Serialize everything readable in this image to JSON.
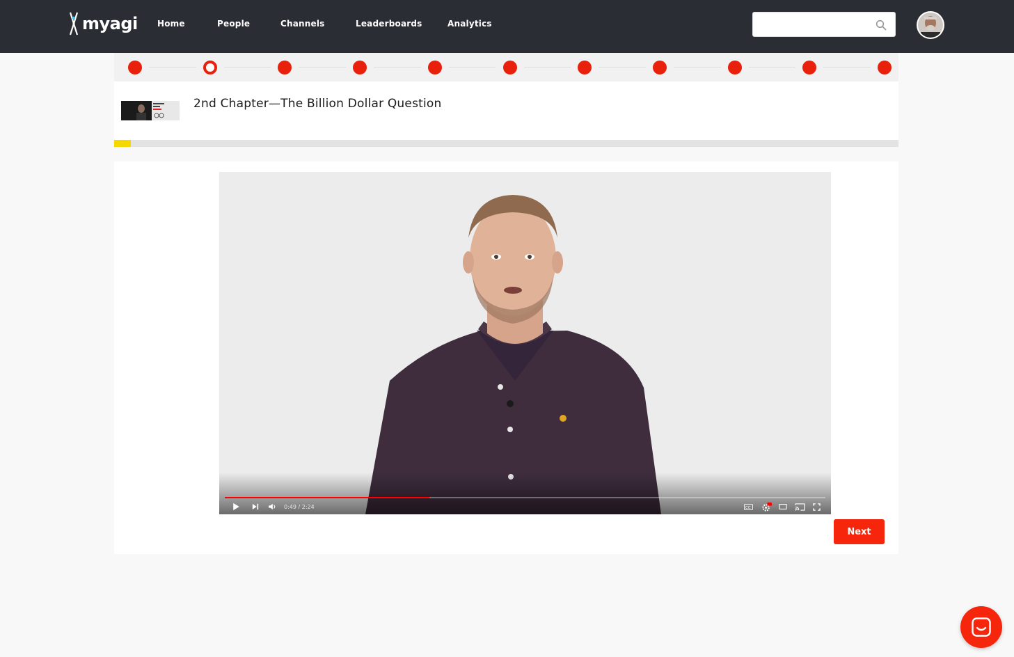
{
  "brand": {
    "logo_text": "myagi",
    "accent": "#f5260b",
    "dot_color": "#e8200c",
    "progress_color": "#f5d800"
  },
  "nav": {
    "items": [
      {
        "label": "Home"
      },
      {
        "label": "People"
      },
      {
        "label": "Channels"
      },
      {
        "label": "Leaderboards"
      },
      {
        "label": "Analytics"
      }
    ]
  },
  "search": {
    "placeholder": "",
    "value": ""
  },
  "chapters": {
    "total": 11,
    "current_index": 1
  },
  "header": {
    "title": "2nd Chapter—The Billion Dollar Question"
  },
  "progress": {
    "percent": 2.1
  },
  "video": {
    "time_display": "0:49 / 2:24",
    "elapsed_seconds": 49,
    "duration_seconds": 144,
    "buffered_fraction": 0.34
  },
  "actions": {
    "next_label": "Next"
  },
  "icons": {
    "search": "search-icon",
    "play": "play-icon",
    "skip": "skip-next-icon",
    "volume": "volume-icon",
    "cc": "captions-icon",
    "settings": "settings-icon",
    "theater": "theater-mode-icon",
    "cast": "cast-icon",
    "fullscreen": "fullscreen-icon",
    "chat": "chat-icon"
  }
}
